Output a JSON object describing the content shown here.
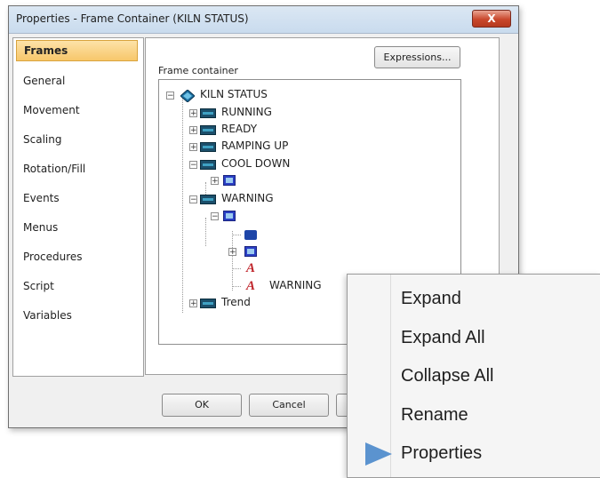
{
  "window": {
    "title": "Properties - Frame Container (KILN STATUS)",
    "close_label": "X"
  },
  "categories": [
    "Frames",
    "General",
    "Movement",
    "Scaling",
    "Rotation/Fill",
    "Events",
    "Menus",
    "Procedures",
    "Script",
    "Variables"
  ],
  "selected_category": "Frames",
  "panel": {
    "frame_container_label": "Frame container",
    "expressions_label": "Expressions..."
  },
  "tree": {
    "root": "KILN STATUS",
    "items": {
      "running": "RUNNING",
      "ready": "READY",
      "ramping_up": "RAMPING UP",
      "cool_down": "COOL DOWN",
      "warning": "WARNING",
      "warning_text": "WARNING",
      "trend": "Trend"
    },
    "expander_plus": "+",
    "expander_minus": "−",
    "text_icon_glyph": "A"
  },
  "buttons": {
    "ok": "OK",
    "cancel": "Cancel"
  },
  "context_menu": {
    "items": [
      "Expand",
      "Expand All",
      "Collapse All",
      "Rename",
      "Properties"
    ],
    "highlighted_item": "Properties"
  },
  "colors": {
    "selection": "#f7c76b",
    "close_button": "#c9472c",
    "menu_arrow": "#5b93cf"
  }
}
